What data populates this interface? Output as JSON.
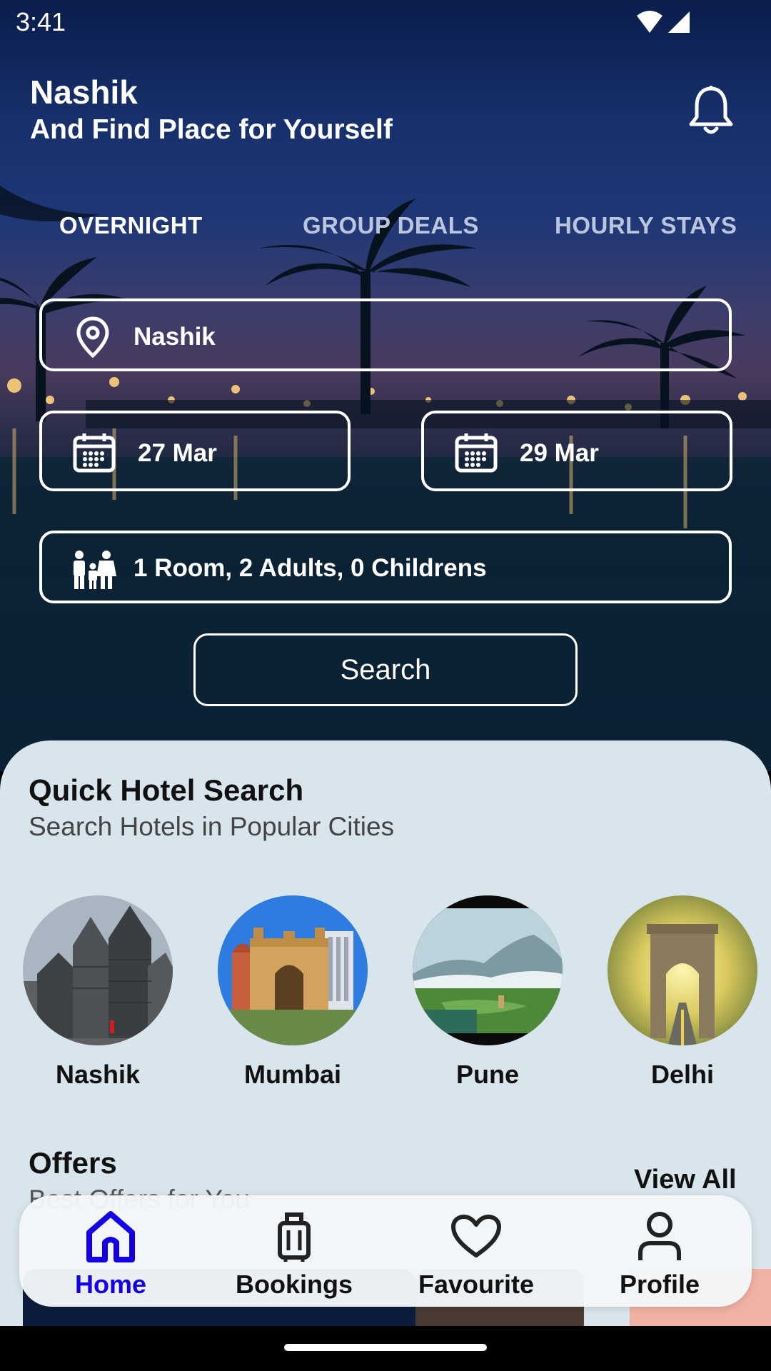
{
  "status_bar": {
    "time": "3:41",
    "icons": [
      "wifi-icon",
      "cellular-signal-icon"
    ]
  },
  "header": {
    "title": "Nashik",
    "subtitle": "And Find Place for Yourself",
    "notification_icon": "bell-icon"
  },
  "tabs": [
    {
      "label": "OVERNIGHT",
      "active": true
    },
    {
      "label": "GROUP DEALS",
      "active": false
    },
    {
      "label": "HOURLY STAYS",
      "active": false
    }
  ],
  "search_form": {
    "location": "Nashik",
    "check_in": "27 Mar",
    "check_out": "29 Mar",
    "guests": "1 Room, 2 Adults, 0 Childrens",
    "search_label": "Search"
  },
  "quick_search": {
    "title": "Quick Hotel Search",
    "subtitle": "Search Hotels in Popular Cities",
    "cities": [
      {
        "name": "Nashik"
      },
      {
        "name": "Mumbai"
      },
      {
        "name": "Pune"
      },
      {
        "name": "Delhi"
      }
    ]
  },
  "offers": {
    "title": "Offers",
    "subtitle": "Best Offers for You",
    "view_all": "View All"
  },
  "bottom_nav": [
    {
      "label": "Home",
      "icon": "home-icon",
      "active": true
    },
    {
      "label": "Bookings",
      "icon": "luggage-icon",
      "active": false
    },
    {
      "label": "Favourite",
      "icon": "heart-icon",
      "active": false
    },
    {
      "label": "Profile",
      "icon": "person-icon",
      "active": false
    }
  ],
  "colors": {
    "accent_active": "#1400e6",
    "sheet_background": "#d9e5ed",
    "tab_inactive": "#b9c6dd"
  }
}
